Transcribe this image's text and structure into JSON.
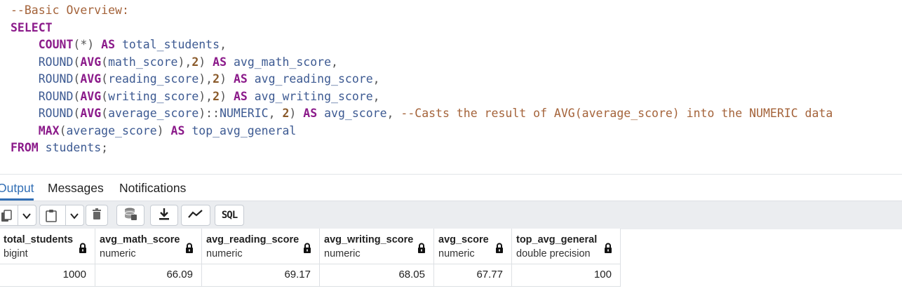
{
  "editor": {
    "lines": [
      [
        {
          "c": "t-comment",
          "t": "--Basic Overview:"
        }
      ],
      [
        {
          "c": "t-kw",
          "t": "SELECT"
        }
      ],
      [
        {
          "c": "t-ident",
          "t": "    "
        },
        {
          "c": "t-fn",
          "t": "COUNT"
        },
        {
          "c": "t-punc",
          "t": "(*) "
        },
        {
          "c": "t-kw",
          "t": "AS"
        },
        {
          "c": "t-ident",
          "t": " total_students"
        },
        {
          "c": "t-punc",
          "t": ","
        }
      ],
      [
        {
          "c": "t-ident",
          "t": "    "
        },
        {
          "c": "t-fnn",
          "t": "ROUND"
        },
        {
          "c": "t-punc",
          "t": "("
        },
        {
          "c": "t-fn",
          "t": "AVG"
        },
        {
          "c": "t-punc",
          "t": "("
        },
        {
          "c": "t-ident",
          "t": "math_score"
        },
        {
          "c": "t-punc",
          "t": "),"
        },
        {
          "c": "t-num",
          "t": "2"
        },
        {
          "c": "t-punc",
          "t": ") "
        },
        {
          "c": "t-kw",
          "t": "AS"
        },
        {
          "c": "t-ident",
          "t": " avg_math_score"
        },
        {
          "c": "t-punc",
          "t": ","
        }
      ],
      [
        {
          "c": "t-ident",
          "t": "    "
        },
        {
          "c": "t-fnn",
          "t": "ROUND"
        },
        {
          "c": "t-punc",
          "t": "("
        },
        {
          "c": "t-fn",
          "t": "AVG"
        },
        {
          "c": "t-punc",
          "t": "("
        },
        {
          "c": "t-ident",
          "t": "reading_score"
        },
        {
          "c": "t-punc",
          "t": "),"
        },
        {
          "c": "t-num",
          "t": "2"
        },
        {
          "c": "t-punc",
          "t": ") "
        },
        {
          "c": "t-kw",
          "t": "AS"
        },
        {
          "c": "t-ident",
          "t": " avg_reading_score"
        },
        {
          "c": "t-punc",
          "t": ","
        }
      ],
      [
        {
          "c": "t-ident",
          "t": "    "
        },
        {
          "c": "t-fnn",
          "t": "ROUND"
        },
        {
          "c": "t-punc",
          "t": "("
        },
        {
          "c": "t-fn",
          "t": "AVG"
        },
        {
          "c": "t-punc",
          "t": "("
        },
        {
          "c": "t-ident",
          "t": "writing_score"
        },
        {
          "c": "t-punc",
          "t": "),"
        },
        {
          "c": "t-num",
          "t": "2"
        },
        {
          "c": "t-punc",
          "t": ") "
        },
        {
          "c": "t-kw",
          "t": "AS"
        },
        {
          "c": "t-ident",
          "t": " avg_writing_score"
        },
        {
          "c": "t-punc",
          "t": ","
        }
      ],
      [
        {
          "c": "t-ident",
          "t": "    "
        },
        {
          "c": "t-fnn",
          "t": "ROUND"
        },
        {
          "c": "t-punc",
          "t": "("
        },
        {
          "c": "t-fn",
          "t": "AVG"
        },
        {
          "c": "t-punc",
          "t": "("
        },
        {
          "c": "t-ident",
          "t": "average_score"
        },
        {
          "c": "t-punc",
          "t": ")::"
        },
        {
          "c": "t-ident",
          "t": "NUMERIC"
        },
        {
          "c": "t-punc",
          "t": ", "
        },
        {
          "c": "t-num",
          "t": "2"
        },
        {
          "c": "t-punc",
          "t": ") "
        },
        {
          "c": "t-kw",
          "t": "AS"
        },
        {
          "c": "t-ident",
          "t": " avg_score"
        },
        {
          "c": "t-punc",
          "t": ", "
        },
        {
          "c": "t-comment",
          "t": "--Casts the result of AVG(average_score) into the NUMERIC data"
        }
      ],
      [
        {
          "c": "t-ident",
          "t": "    "
        },
        {
          "c": "t-fn",
          "t": "MAX"
        },
        {
          "c": "t-punc",
          "t": "("
        },
        {
          "c": "t-ident",
          "t": "average_score"
        },
        {
          "c": "t-punc",
          "t": ") "
        },
        {
          "c": "t-kw",
          "t": "AS"
        },
        {
          "c": "t-ident",
          "t": " top_avg_general"
        }
      ],
      [
        {
          "c": "t-kw",
          "t": "FROM"
        },
        {
          "c": "t-ident",
          "t": " students"
        },
        {
          "c": "t-punc",
          "t": ";"
        }
      ]
    ]
  },
  "tabs": {
    "output": "Output",
    "messages": "Messages",
    "notifications": "Notifications"
  },
  "toolbar": {
    "icons": [
      "copy-icon",
      "chevron-down-icon",
      "paste-icon",
      "chevron-down-icon",
      "delete-icon",
      "save-data-icon",
      "download-icon",
      "graph-icon"
    ],
    "sql_label": "SQL"
  },
  "grid": {
    "columns": [
      {
        "name": "total_students",
        "type": "bigint"
      },
      {
        "name": "avg_math_score",
        "type": "numeric"
      },
      {
        "name": "avg_reading_score",
        "type": "numeric"
      },
      {
        "name": "avg_writing_score",
        "type": "numeric"
      },
      {
        "name": "avg_score",
        "type": "numeric"
      },
      {
        "name": "top_avg_general",
        "type": "double precision"
      }
    ],
    "rows": [
      [
        "1000",
        "66.09",
        "69.17",
        "68.05",
        "67.77",
        "100"
      ]
    ]
  }
}
